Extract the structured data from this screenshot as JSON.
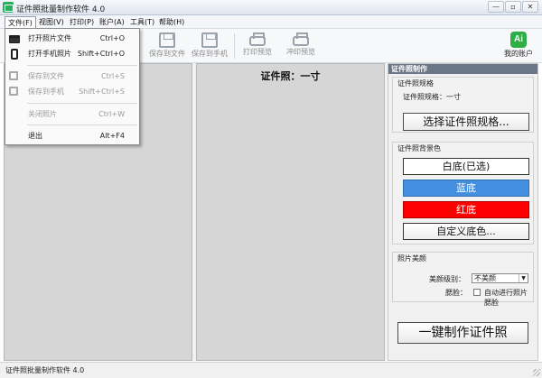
{
  "window": {
    "title": "证件照批量制作软件 4.0",
    "controls": [
      "—",
      "▫",
      "✕"
    ]
  },
  "menubar": {
    "items": [
      "文件(F)",
      "视图(V)",
      "打印(P)",
      "账户(A)",
      "工具(T)",
      "帮助(H)"
    ]
  },
  "toolbar": {
    "buttons": [
      {
        "label": "保存到文件",
        "icon": "save-icon"
      },
      {
        "label": "保存到手机",
        "icon": "save-to-phone-icon"
      },
      {
        "label": "打印预览",
        "icon": "printer-icon"
      },
      {
        "label": "冲印预览",
        "icon": "photo-print-icon"
      }
    ],
    "account": {
      "icon_text": "Ai",
      "label": "我的账户"
    }
  },
  "file_menu": {
    "items": [
      {
        "label": "打开照片文件",
        "shortcut": "Ctrl+O",
        "enabled": true,
        "icon": "folder-open-icon"
      },
      {
        "label": "打开手机照片",
        "shortcut": "Shift+Ctrl+O",
        "enabled": true,
        "icon": "phone-icon"
      },
      {
        "label": "保存到文件",
        "shortcut": "Ctrl+S",
        "enabled": false,
        "icon": "save-icon"
      },
      {
        "label": "保存到手机",
        "shortcut": "Shift+Ctrl+S",
        "enabled": false,
        "icon": "save-to-phone-icon"
      },
      {
        "label": "关闭照片",
        "shortcut": "Ctrl+W",
        "enabled": false
      },
      {
        "label": "退出",
        "shortcut": "Alt+F4",
        "enabled": true
      }
    ]
  },
  "canvas": {
    "center_title": "证件照：一寸"
  },
  "right_panel": {
    "header": "证件照制作",
    "spec_group": {
      "title": "证件照规格",
      "current": "证件照规格：一寸",
      "select_button": "选择证件照规格..."
    },
    "bg_group": {
      "title": "证件照背景色",
      "options": [
        {
          "label": "白底(已选)",
          "bg": "#ffffff",
          "fg": "#111111"
        },
        {
          "label": "蓝底",
          "bg": "#438ede",
          "fg": "#ffffff"
        },
        {
          "label": "红底",
          "bg": "#ff0000",
          "fg": "#ffffff"
        },
        {
          "label": "自定义底色...",
          "bg": "#ffffff",
          "fg": "#111111"
        }
      ]
    },
    "beauty_group": {
      "title": "照片美颜",
      "level_label": "美颜级别：",
      "level_value": "不美颜",
      "face_label": "腮脸：",
      "auto_face_label": "自动进行照片腮脸",
      "auto_face_checked": false
    },
    "make_button": "一键制作证件照"
  },
  "statusbar": {
    "text": "证件照批量制作软件 4.0"
  }
}
